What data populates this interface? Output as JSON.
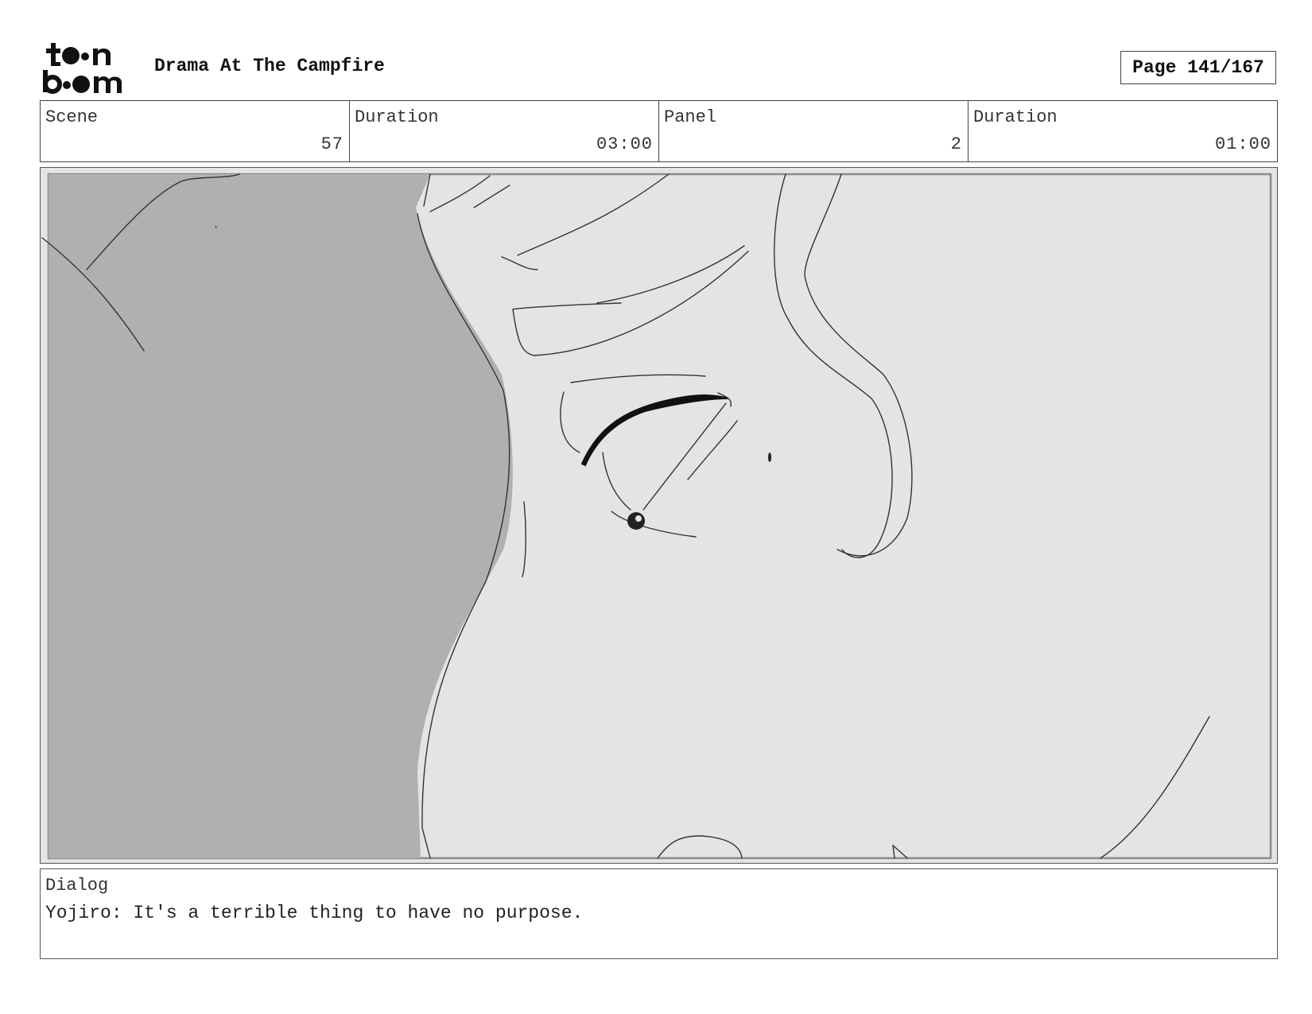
{
  "header": {
    "logo_text": "toon boom",
    "title": "Drama At The Campfire",
    "page": "Page 141/167"
  },
  "info": {
    "scene_label": "Scene",
    "scene_value": "57",
    "scene_duration_label": "Duration",
    "scene_duration_value": "03:00",
    "panel_label": "Panel",
    "panel_value": "2",
    "panel_duration_label": "Duration",
    "panel_duration_value": "01:00"
  },
  "dialog": {
    "label": "Dialog",
    "text": "Yojiro: It's a terrible thing to have no purpose."
  }
}
